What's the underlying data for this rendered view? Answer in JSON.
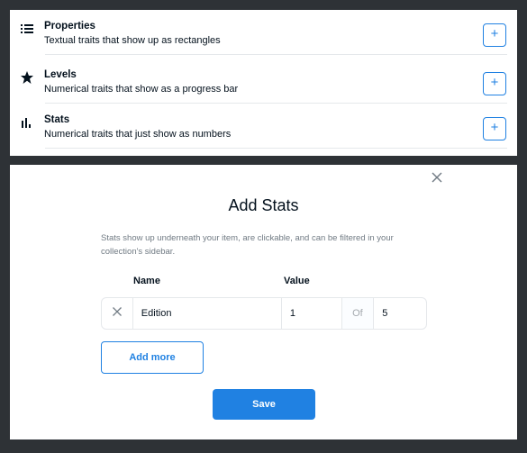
{
  "traits": [
    {
      "icon": "list-icon",
      "title": "Properties",
      "description": "Textual traits that show up as rectangles",
      "add_label": "+"
    },
    {
      "icon": "star-icon",
      "title": "Levels",
      "description": "Numerical traits that show as a progress bar",
      "add_label": "+"
    },
    {
      "icon": "bar-chart-icon",
      "title": "Stats",
      "description": "Numerical traits that just show as numbers",
      "add_label": "+"
    }
  ],
  "modal": {
    "close_icon": "close-icon",
    "title": "Add Stats",
    "description": "Stats show up underneath your item, are clickable, and can be filtered in your collection's sidebar.",
    "columns": {
      "name": "Name",
      "value": "Value"
    },
    "rows": [
      {
        "name": "Edition",
        "value": "1",
        "of_label": "Of",
        "max": "5"
      }
    ],
    "add_more_label": "Add more",
    "save_label": "Save"
  },
  "colors": {
    "accent": "#2081e2",
    "background": "#2e3236",
    "border": "#e5e8eb",
    "muted_text": "#707a83"
  }
}
